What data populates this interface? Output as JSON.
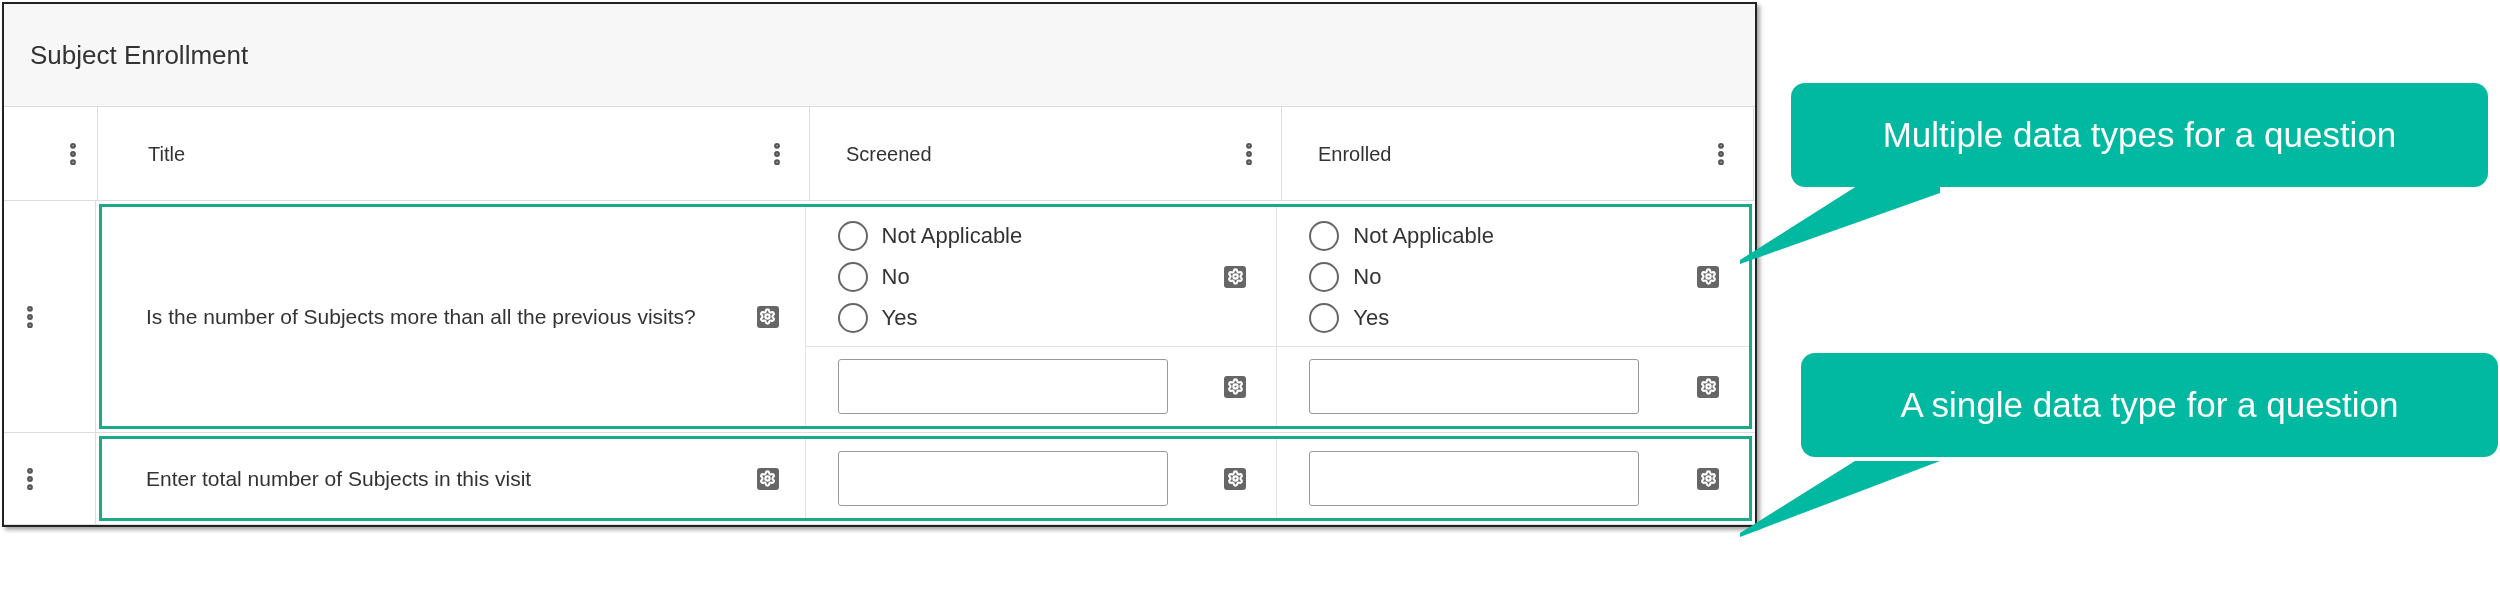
{
  "panel": {
    "title": "Subject Enrollment"
  },
  "columns": [
    {
      "label": "Title"
    },
    {
      "label": "Screened"
    },
    {
      "label": "Enrolled"
    }
  ],
  "rows": [
    {
      "question": "Is the number of Subjects more than all the previous visits?",
      "cells": [
        {
          "parts": [
            {
              "kind": "radio",
              "options": [
                {
                  "label": "Not Applicable",
                  "selected": false
                },
                {
                  "label": "No",
                  "selected": false
                },
                {
                  "label": "Yes",
                  "selected": false
                }
              ]
            },
            {
              "kind": "text"
            }
          ]
        },
        {
          "parts": [
            {
              "kind": "radio",
              "options": [
                {
                  "label": "Not Applicable",
                  "selected": false
                },
                {
                  "label": "No",
                  "selected": false
                },
                {
                  "label": "Yes",
                  "selected": false
                }
              ]
            },
            {
              "kind": "text"
            }
          ]
        }
      ]
    },
    {
      "question": "Enter total number of Subjects in this visit",
      "cells": [
        {
          "parts": [
            {
              "kind": "text"
            }
          ]
        },
        {
          "parts": [
            {
              "kind": "text"
            }
          ]
        }
      ]
    }
  ],
  "callouts": [
    {
      "text": "Multiple data types for a question"
    },
    {
      "text": "A single data type for a question"
    }
  ]
}
